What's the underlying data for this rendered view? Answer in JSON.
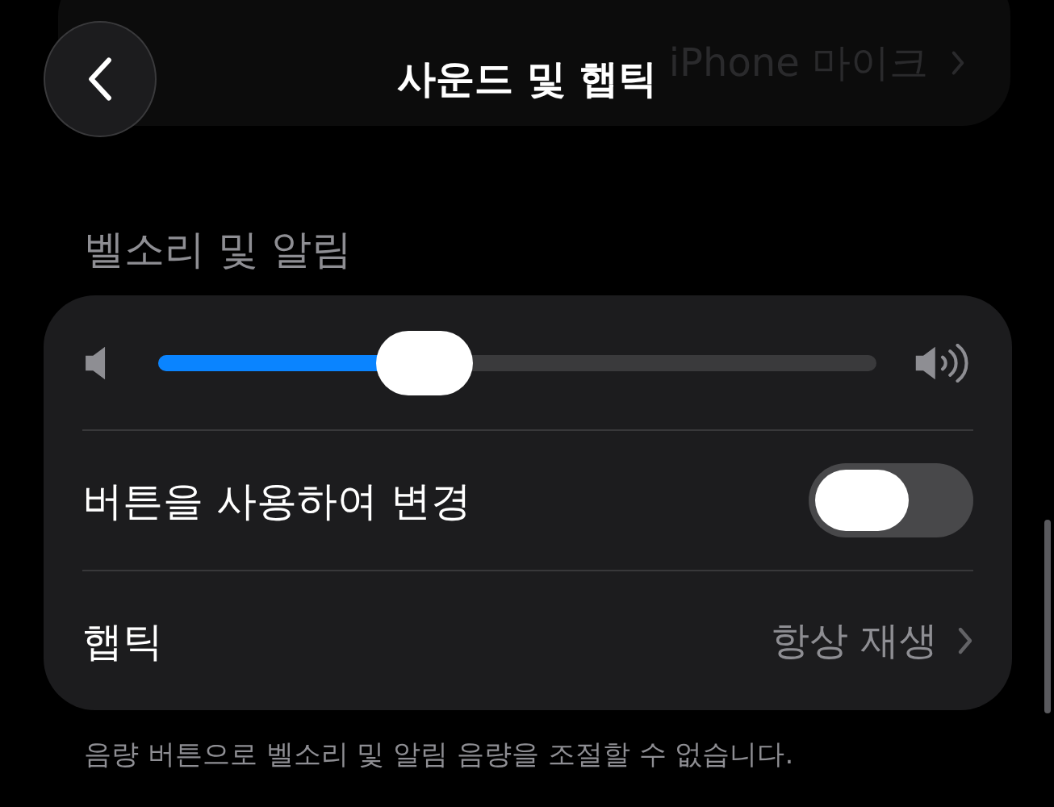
{
  "behind_header_row": {
    "value": "iPhone 마이크"
  },
  "header": {
    "title": "사운드 및 햅틱"
  },
  "section": {
    "title": "벨소리 및 알림",
    "volume": {
      "level": 0.37
    },
    "toggle_row": {
      "label": "버튼을 사용하여 변경",
      "on": false
    },
    "haptic_row": {
      "label": "햅틱",
      "value": "항상 재생"
    },
    "footer": "음량 버튼으로 벨소리 및 알림 음량을 조절할 수 없습니다."
  }
}
